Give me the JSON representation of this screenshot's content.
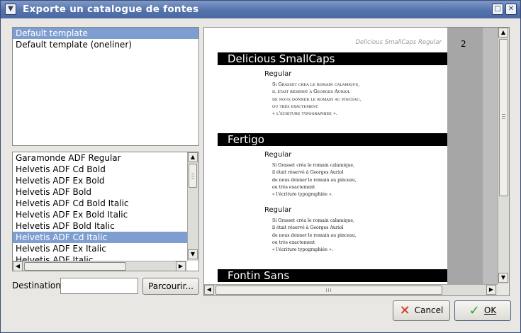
{
  "window": {
    "title": "Exporte un catalogue de fontes"
  },
  "templates": [
    "Default template",
    "Default template (oneliner)"
  ],
  "selected_template_index": 0,
  "fonts": [
    "Garamonde ADF Regular",
    "Helvetis ADF Cd Bold",
    "Helvetis ADF Ex Bold",
    "Helvetis ADF Bold",
    "Helvetis ADF Cd Bold Italic",
    "Helvetis ADF Ex Bold Italic",
    "Helvetis ADF Bold Italic",
    "Helvetis ADF Cd Italic",
    "Helvetis ADF Ex Italic",
    "Helvetis ADF Italic"
  ],
  "selected_font_index": 7,
  "destination": {
    "label": "Destination",
    "value": ""
  },
  "browse_button": "Parcourir...",
  "preview": {
    "page_number": "2",
    "header_text": "Delicious SmallCaps Regular",
    "fonts": [
      {
        "name": "Delicious SmallCaps",
        "styles": [
          "Regular"
        ]
      },
      {
        "name": "Fertigo",
        "styles": [
          "Regular",
          "Regular"
        ]
      },
      {
        "name": "Fontin Sans",
        "styles": []
      }
    ],
    "sample_lines": [
      "Si Grasset créa le romain calamique,",
      "il était réservé à Georges Auriol",
      "de nous donner le romain au pinceau,",
      "ou très exactement",
      "« l'écriture typographiée »."
    ]
  },
  "buttons": {
    "cancel": "Cancel",
    "ok": "OK"
  },
  "icons": {
    "menu": "chevron-down-icon",
    "maximize": "maximize-icon",
    "close": "close-icon",
    "cancel": "cancel-x-icon",
    "ok": "checkmark-icon"
  }
}
